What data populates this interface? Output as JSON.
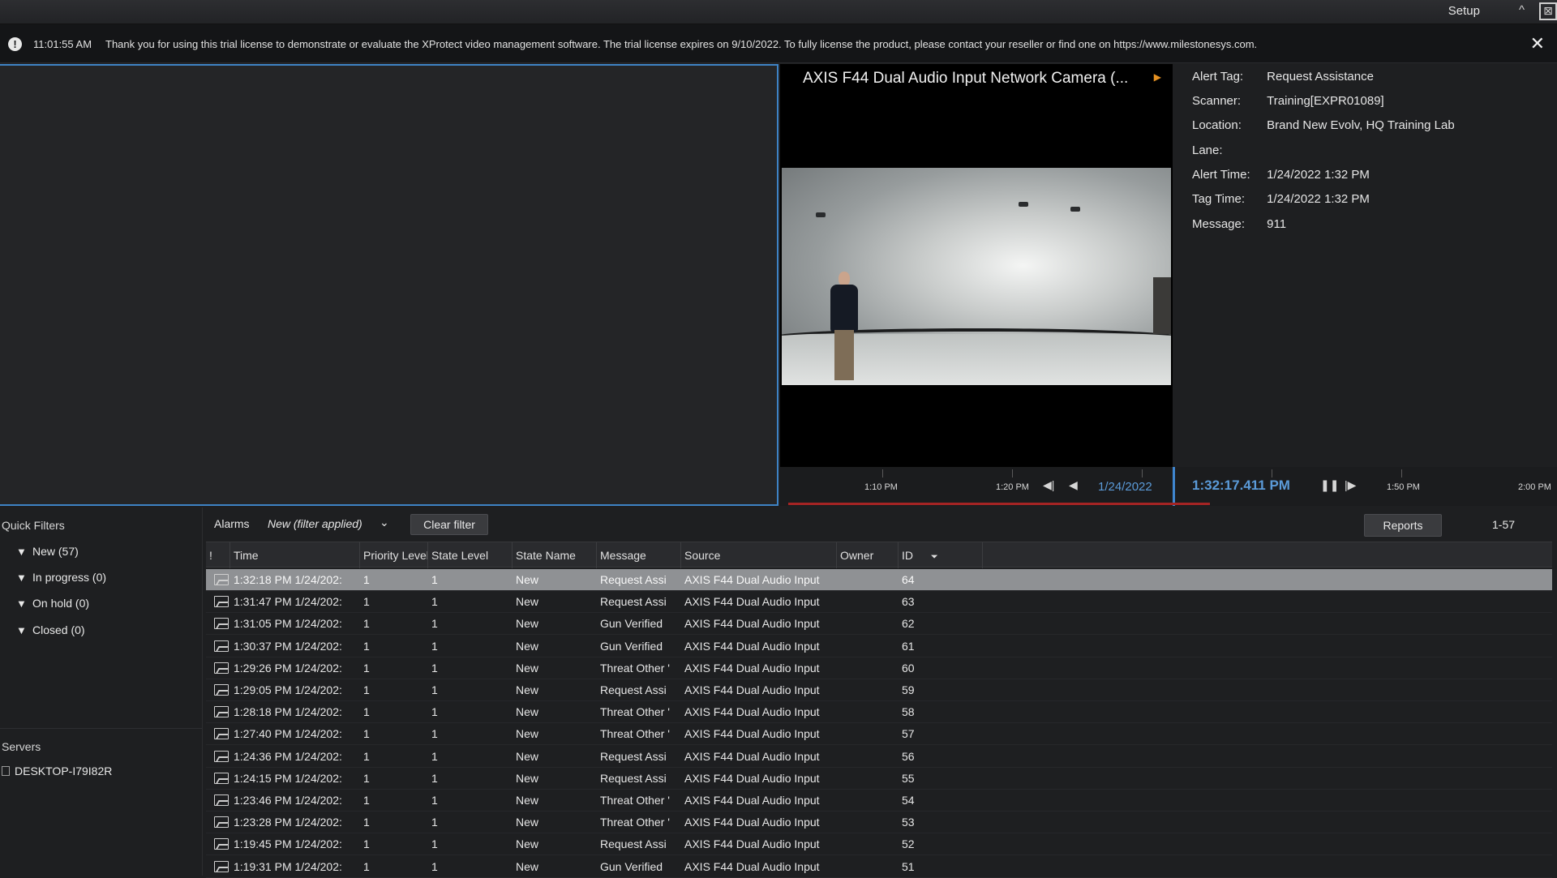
{
  "topbar": {
    "setup_label": "Setup",
    "collapse_glyph": "^",
    "window_glyph": "⊠"
  },
  "notification": {
    "icon": "!",
    "time": "11:01:55 AM",
    "text": "Thank you for using this trial license to demonstrate or evaluate the XProtect video management software. The trial license expires on 9/10/2022. To fully license the product, please contact your reseller or find one on https://www.milestonesys.com.",
    "close": "✕"
  },
  "camera": {
    "title": "AXIS F44 Dual Audio Input Network Camera (...",
    "arrow": "▶"
  },
  "details": {
    "rows": [
      {
        "label": "Alert Tag:",
        "value": "Request Assistance"
      },
      {
        "label": "Scanner:",
        "value": "Training[EXPR01089]"
      },
      {
        "label": "Location:",
        "value": "Brand New Evolv, HQ Training Lab"
      },
      {
        "label": "Lane:",
        "value": ""
      },
      {
        "label": "Alert Time:",
        "value": "1/24/2022 1:32 PM"
      },
      {
        "label": "Tag Time:",
        "value": "1/24/2022 1:32 PM"
      },
      {
        "label": "Message:",
        "value": "911"
      }
    ]
  },
  "timeline": {
    "labels": [
      "1:10 PM",
      "1:20 PM",
      "1:50 PM",
      "2:00 PM"
    ],
    "date": "1/24/2022",
    "current_time": "1:32:17.411 PM",
    "controls": {
      "prev_frame": "◀|",
      "play_reverse": "◀",
      "pause": "❚❚",
      "next_frame": "|▶"
    }
  },
  "quick_filters": {
    "title": "Quick Filters",
    "items": [
      "New (57)",
      "In progress (0)",
      "On hold (0)",
      "Closed (0)"
    ],
    "servers_title": "Servers",
    "server": "DESKTOP-I79I82R"
  },
  "alarm_list": {
    "alarms_label": "Alarms",
    "filter_label": "New (filter applied)",
    "filter_chevron": "⌄",
    "clear_filter_label": "Clear filter",
    "reports_label": "Reports",
    "range_label": "1-57",
    "columns": [
      "!",
      "Time",
      "Priority Level",
      "State Level",
      "State Name",
      "Message",
      "Source",
      "Owner",
      "ID"
    ],
    "sort_indicator": "⏷",
    "rows": [
      {
        "time": "1:32:18 PM 1/24/202:",
        "priority": "1",
        "state_level": "1",
        "state_name": "New",
        "message": "Request Assi",
        "source": "AXIS F44 Dual Audio Input",
        "owner": "",
        "id": "64"
      },
      {
        "time": "1:31:47 PM 1/24/202:",
        "priority": "1",
        "state_level": "1",
        "state_name": "New",
        "message": "Request Assi",
        "source": "AXIS F44 Dual Audio Input",
        "owner": "",
        "id": "63"
      },
      {
        "time": "1:31:05 PM 1/24/202:",
        "priority": "1",
        "state_level": "1",
        "state_name": "New",
        "message": "Gun Verified",
        "source": "AXIS F44 Dual Audio Input",
        "owner": "",
        "id": "62"
      },
      {
        "time": "1:30:37 PM 1/24/202:",
        "priority": "1",
        "state_level": "1",
        "state_name": "New",
        "message": "Gun Verified",
        "source": "AXIS F44 Dual Audio Input",
        "owner": "",
        "id": "61"
      },
      {
        "time": "1:29:26 PM 1/24/202:",
        "priority": "1",
        "state_level": "1",
        "state_name": "New",
        "message": "Threat Other '",
        "source": "AXIS F44 Dual Audio Input",
        "owner": "",
        "id": "60"
      },
      {
        "time": "1:29:05 PM 1/24/202:",
        "priority": "1",
        "state_level": "1",
        "state_name": "New",
        "message": "Request Assi",
        "source": "AXIS F44 Dual Audio Input",
        "owner": "",
        "id": "59"
      },
      {
        "time": "1:28:18 PM 1/24/202:",
        "priority": "1",
        "state_level": "1",
        "state_name": "New",
        "message": "Threat Other '",
        "source": "AXIS F44 Dual Audio Input",
        "owner": "",
        "id": "58"
      },
      {
        "time": "1:27:40 PM 1/24/202:",
        "priority": "1",
        "state_level": "1",
        "state_name": "New",
        "message": "Threat Other '",
        "source": "AXIS F44 Dual Audio Input",
        "owner": "",
        "id": "57"
      },
      {
        "time": "1:24:36 PM 1/24/202:",
        "priority": "1",
        "state_level": "1",
        "state_name": "New",
        "message": "Request Assi",
        "source": "AXIS F44 Dual Audio Input",
        "owner": "",
        "id": "56"
      },
      {
        "time": "1:24:15 PM 1/24/202:",
        "priority": "1",
        "state_level": "1",
        "state_name": "New",
        "message": "Request Assi",
        "source": "AXIS F44 Dual Audio Input",
        "owner": "",
        "id": "55"
      },
      {
        "time": "1:23:46 PM 1/24/202:",
        "priority": "1",
        "state_level": "1",
        "state_name": "New",
        "message": "Threat Other '",
        "source": "AXIS F44 Dual Audio Input",
        "owner": "",
        "id": "54"
      },
      {
        "time": "1:23:28 PM 1/24/202:",
        "priority": "1",
        "state_level": "1",
        "state_name": "New",
        "message": "Threat Other '",
        "source": "AXIS F44 Dual Audio Input",
        "owner": "",
        "id": "53"
      },
      {
        "time": "1:19:45 PM 1/24/202:",
        "priority": "1",
        "state_level": "1",
        "state_name": "New",
        "message": "Request Assi",
        "source": "AXIS F44 Dual Audio Input",
        "owner": "",
        "id": "52"
      },
      {
        "time": "1:19:31 PM 1/24/202:",
        "priority": "1",
        "state_level": "1",
        "state_name": "New",
        "message": "Gun Verified",
        "source": "AXIS F44 Dual Audio Input",
        "owner": "",
        "id": "51"
      }
    ],
    "selected_index": 0
  }
}
